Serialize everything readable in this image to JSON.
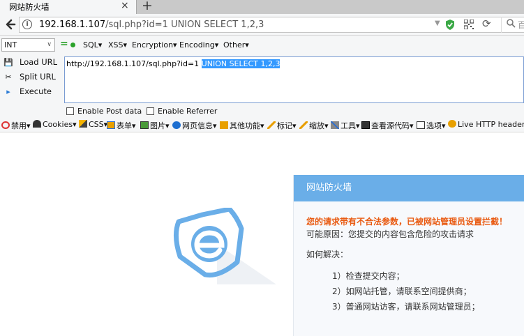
{
  "tab": {
    "title": "网站防火墙",
    "close_glyph": "×",
    "new_tab_glyph": "+"
  },
  "urlbar": {
    "host": "192.168.1.107",
    "path": "/sql.php?id=1 UNION SELECT 1,2,3",
    "search_placeholder": "百"
  },
  "hackbar": {
    "select_value": "INT",
    "menus": [
      "SQL▾",
      "XSS▾",
      "Encryption▾",
      "Encoding▾",
      "Other▾"
    ],
    "load_url": "Load URL",
    "split_url": "Split URL",
    "execute": "Execute",
    "textarea_prefix": "http://192.168.1.107/sql.php?id=1 ",
    "textarea_selected": "UNION SELECT 1,2,3",
    "enable_post": "Enable Post data",
    "enable_referrer": "Enable Referrer"
  },
  "devbar": {
    "items": [
      "禁用▾",
      "Cookies▾",
      "CSS▾",
      "表单▾",
      "图片▾",
      "网页信息▾",
      "其他功能▾",
      "标记▾",
      "缩放▾",
      "工具▾",
      "查看源代码▾",
      "选项▾",
      "Live HTTP headers"
    ]
  },
  "waf": {
    "header": "网站防火墙",
    "warning": "您的请求带有不合法参数，已被网站管理员设置拦截！",
    "reason": "可能原因：您提交的内容包含危险的攻击请求",
    "howto": "如何解决：",
    "steps": [
      "1）检查提交内容；",
      "2）如网站托管，请联系空间提供商；",
      "3）普通网站访客，请联系网站管理员；"
    ]
  },
  "colors": {
    "panel_header": "#6aaee8",
    "warning": "#e95a11",
    "logo": "#6aaee8",
    "selection": "#3399ff"
  }
}
